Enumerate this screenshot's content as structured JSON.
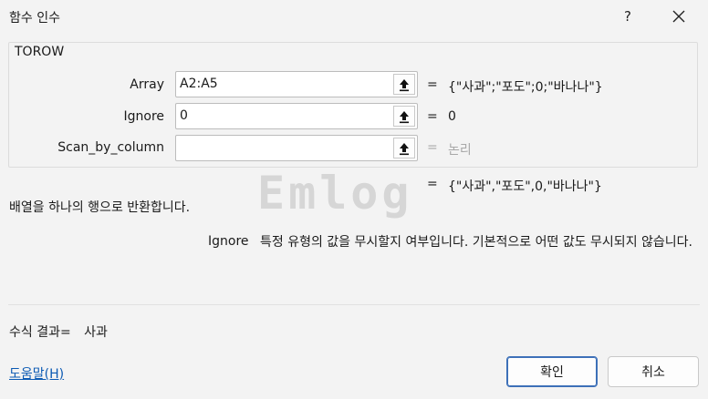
{
  "dialog": {
    "title": "함수 인수",
    "help_glyph": "?",
    "close_glyph": "✕"
  },
  "function": {
    "name": "TOROW",
    "args": [
      {
        "label": "Array",
        "value": "A2:A5",
        "equals": "=",
        "result": "{\"사과\";\"포도\";0;\"바나나\"}"
      },
      {
        "label": "Ignore",
        "value": "0",
        "equals": "=",
        "result": "0"
      },
      {
        "label": "Scan_by_column",
        "value": "",
        "equals": "=",
        "result": "논리"
      }
    ],
    "overall_equals": "=",
    "overall_result": "{\"사과\",\"포도\",0,\"바나나\"}",
    "description": "배열을 하나의 행으로 반환합니다.",
    "arg_desc_name": "Ignore",
    "arg_desc_text": "특정 유형의 값을 무시할지 여부입니다. 기본적으로 어떤 값도 무시되지 않습니다."
  },
  "watermark": "Emlog",
  "formula_result": {
    "label": "수식 결과=",
    "value": "사과"
  },
  "footer": {
    "help_link": "도움말(H)",
    "ok": "확인",
    "cancel": "취소"
  }
}
